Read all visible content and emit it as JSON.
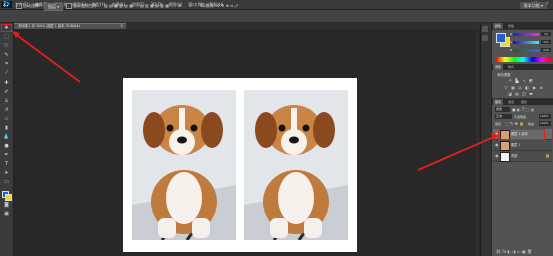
{
  "app": {
    "logo": "Ps"
  },
  "menu": [
    "文件(F)",
    "编辑(E)",
    "图像(I)",
    "图层(L)",
    "类型(Y)",
    "选择(S)",
    "滤镜(T)",
    "3D(D)",
    "视图(V)",
    "窗口(W)",
    "帮助(H)"
  ],
  "window_controls": [
    "—",
    "□",
    "✕"
  ],
  "options_bar": {
    "auto_select": "自动选择:",
    "layer_dropdown": "图层",
    "show_transform": "显示变换控件",
    "workspace": "基本功能"
  },
  "document_tab": {
    "title": "未标题-1 @ 100% (图层 1 副本, RGB/8#)",
    "close": "×"
  },
  "panels": {
    "color_tabs": [
      "颜色",
      "色板"
    ],
    "sliders": [
      {
        "label": "R",
        "value": "43"
      },
      {
        "label": "G",
        "value": "101"
      },
      {
        "label": "B",
        "value": "228"
      }
    ],
    "adjust_tabs": [
      "调整",
      "样式"
    ],
    "adjust_title": "添加调整",
    "layers_tabs": [
      "图层",
      "通道",
      "路径"
    ],
    "kind_filter": "类型",
    "blend_mode": "正常",
    "opacity_label": "不透明度:",
    "opacity_value": "100%",
    "lock_label": "锁定:",
    "fill_label": "填充:",
    "fill_value": "100%",
    "layers": [
      {
        "name": "图层 1 副本",
        "selected": true,
        "kind": "pixel"
      },
      {
        "name": "图层 1",
        "selected": false,
        "kind": "pixel"
      },
      {
        "name": "背景",
        "selected": false,
        "kind": "background"
      }
    ]
  },
  "colors": {
    "foreground": "#1f5fd6",
    "background": "#f0d81a",
    "annotation": "#e02020"
  }
}
